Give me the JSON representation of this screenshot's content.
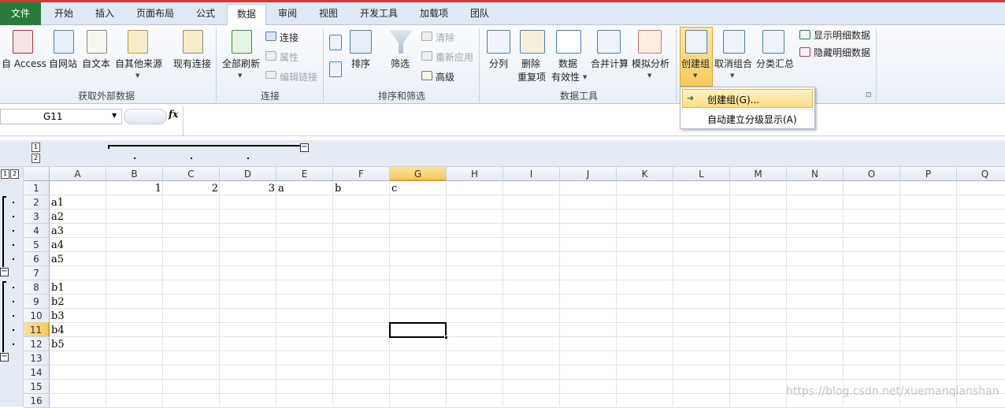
{
  "tabs": {
    "file": "文件",
    "home": "开始",
    "insert": "插入",
    "layout": "页面布局",
    "formulas": "公式",
    "data": "数据",
    "review": "审阅",
    "view": "视图",
    "developer": "开发工具",
    "addins": "加载项",
    "team": "团队"
  },
  "ribbon": {
    "access": "自 Access",
    "web": "自网站",
    "text": "自文本",
    "other": "自其他来源",
    "existing": "现有连接",
    "group_external": "获取外部数据",
    "refresh_all": "全部刷新",
    "connections": "连接",
    "properties": "属性",
    "edit_links": "编辑链接",
    "group_connections": "连接",
    "sort": "排序",
    "filter": "筛选",
    "clear": "清除",
    "reapply": "重新应用",
    "advanced": "高级",
    "group_sort": "排序和筛选",
    "split": "分列",
    "remove_dup_1": "删除",
    "remove_dup_2": "重复项",
    "validation_1": "数据",
    "validation_2": "有效性",
    "consolidate": "合并计算",
    "whatif": "模拟分析",
    "group_tools": "数据工具",
    "group_btn": "创建组",
    "ungroup": "取消组合",
    "subtotal": "分类汇总",
    "show_detail": "显示明细数据",
    "hide_detail": "隐藏明细数据"
  },
  "dropdown": {
    "item1": "创建组(G)...",
    "item2": "自动建立分级显示(A)"
  },
  "formula_bar": {
    "name_box": "G11",
    "fx": "fx",
    "content": ""
  },
  "outline": {
    "col_levels": [
      "1",
      "2"
    ],
    "row_levels": [
      "1",
      "2"
    ]
  },
  "sheet": {
    "columns": [
      "A",
      "B",
      "C",
      "D",
      "E",
      "F",
      "G",
      "H",
      "I",
      "J",
      "K",
      "L",
      "M",
      "N",
      "O",
      "P",
      "Q"
    ],
    "rows": [
      "1",
      "2",
      "3",
      "4",
      "5",
      "6",
      "7",
      "8",
      "9",
      "10",
      "11",
      "12",
      "13",
      "14",
      "15",
      "16"
    ],
    "selected_cell": "G11",
    "cells": {
      "B1": "1",
      "C1": "2",
      "D1": "3",
      "E1": "a",
      "F1": "b",
      "G1": "c",
      "A2": "a1",
      "A3": "a2",
      "A4": "a3",
      "A5": "a4",
      "A6": "a5",
      "A8": "b1",
      "A9": "b2",
      "A10": "b3",
      "A11": "b4",
      "A12": "b5"
    }
  },
  "watermark": "https://blog.csdn.net/xuemanqianshan",
  "colors": {
    "file_tab": "#2a7a3b",
    "selection_header": "#f7c95c",
    "accent": "#d33"
  }
}
